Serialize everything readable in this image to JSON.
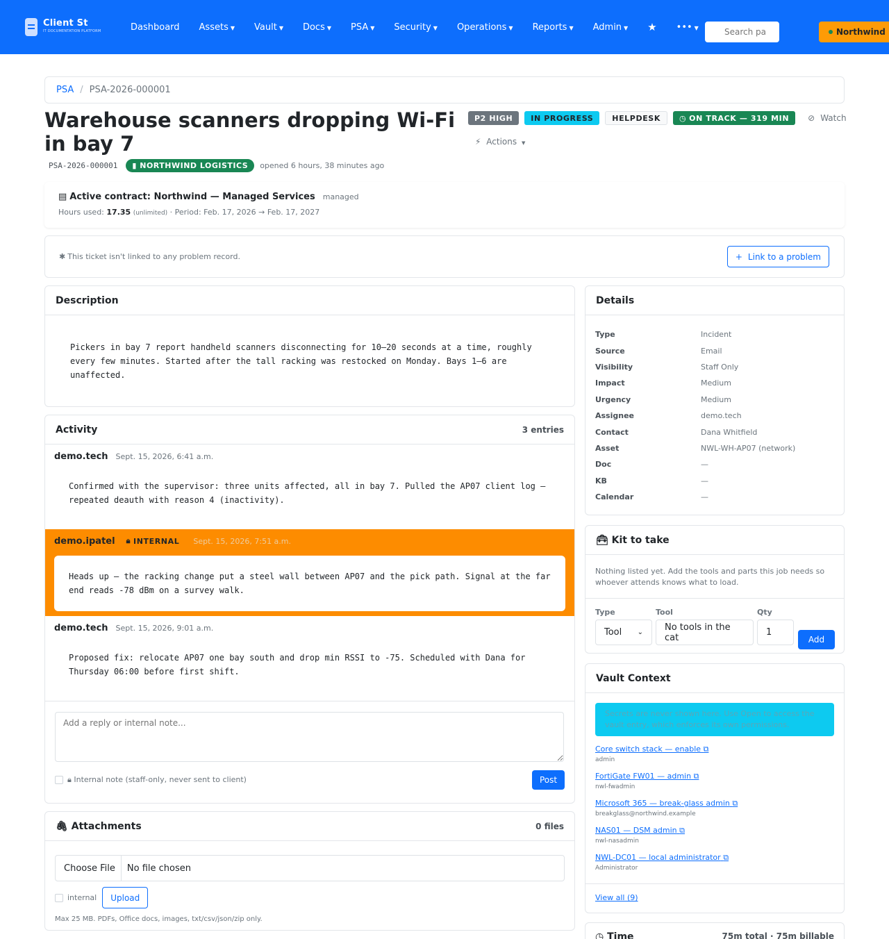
{
  "nav": {
    "brand_name": "Client St",
    "brand_sub": "IT DOCUMENTATION PLATFORM",
    "items": [
      "Dashboard",
      "Assets",
      "Vault",
      "Docs",
      "PSA",
      "Security",
      "Operations",
      "Reports",
      "Admin"
    ],
    "search_placeholder": "Search pa",
    "tenant": "Northwind L"
  },
  "breadcrumb": {
    "root": "PSA",
    "sep": "/",
    "current": "PSA-2026-000001"
  },
  "ticket": {
    "title": "Warehouse scanners dropping Wi-Fi in bay 7",
    "id": "PSA-2026-000001",
    "client": "NORTHWIND LOGISTICS",
    "opened": "opened 6 hours, 38 minutes ago",
    "priority": "P2 HIGH",
    "status": "IN PROGRESS",
    "queue": "HELPDESK",
    "sla": "ON TRACK — 319 MIN",
    "watch": "Watch",
    "actions": "Actions"
  },
  "contract": {
    "title": "Active contract: Northwind — Managed Services",
    "tag": "managed",
    "hours_label": "Hours used:",
    "hours": "17.35",
    "unlimited": "(unlimited)",
    "period": "· Period: Feb. 17, 2026 → Feb. 17, 2027"
  },
  "problem": {
    "text": "This ticket isn't linked to any problem record.",
    "button": "Link to a problem"
  },
  "description": {
    "title": "Description",
    "text": "Pickers in bay 7 report handheld scanners disconnecting for 10–20 seconds at a time, roughly every few minutes. Started after the tall racking was restocked on Monday. Bays 1–6 are unaffected."
  },
  "activity": {
    "title": "Activity",
    "count": "3 entries",
    "entries": [
      {
        "author": "demo.tech",
        "time": "Sept. 15, 2026, 6:41 a.m.",
        "body": "Confirmed with the supervisor: three units affected, all in bay 7. Pulled the AP07 client log — repeated deauth with reason 4 (inactivity)."
      },
      {
        "author": "demo.ipatel",
        "tag": "INTERNAL",
        "time": "Sept. 15, 2026, 7:51 a.m.",
        "body": "Heads up — the racking change put a steel wall between AP07 and the pick path. Signal at the far end reads -78 dBm on a survey walk."
      },
      {
        "author": "demo.tech",
        "time": "Sept. 15, 2026, 9:01 a.m.",
        "body": "Proposed fix: relocate AP07 one bay south and drop min RSSI to -75. Scheduled with Dana for Thursday 06:00 before first shift."
      }
    ],
    "reply_placeholder": "Add a reply or internal note...",
    "internal_label": "Internal note (staff-only, never sent to client)",
    "post": "Post"
  },
  "attachments": {
    "title": "Attachments",
    "count": "0 files",
    "choose": "Choose File",
    "no_file": "No file chosen",
    "internal": "internal",
    "upload": "Upload",
    "note": "Max 25 MB. PDFs, Office docs, images, txt/csv/json/zip only."
  },
  "details": {
    "title": "Details",
    "rows": [
      {
        "label": "Type",
        "value": "Incident"
      },
      {
        "label": "Source",
        "value": "Email"
      },
      {
        "label": "Visibility",
        "value": "Staff Only"
      },
      {
        "label": "Impact",
        "value": "Medium"
      },
      {
        "label": "Urgency",
        "value": "Medium"
      },
      {
        "label": "Assignee",
        "value": "demo.tech"
      },
      {
        "label": "Contact",
        "value": "Dana Whitfield"
      },
      {
        "label": "Asset",
        "value": "NWL-WH-AP07 (network)"
      },
      {
        "label": "Doc",
        "value": "—"
      },
      {
        "label": "KB",
        "value": "—"
      },
      {
        "label": "Calendar",
        "value": "—"
      }
    ]
  },
  "kit": {
    "title": "Kit to take",
    "text": "Nothing listed yet. Add the tools and parts this job needs so whoever attends knows what to load.",
    "type_label": "Type",
    "tool_label": "Tool",
    "qty_label": "Qty",
    "type_value": "Tool",
    "tool_value": "No tools in the cat",
    "qty_value": "1",
    "add": "Add"
  },
  "vault": {
    "title": "Vault Context",
    "alert": "Secrets are never shown here. Use Open to access the vault entry, which enforces its own permissions.",
    "items": [
      {
        "name": "Core switch stack — enable",
        "user": "admin"
      },
      {
        "name": "FortiGate FW01 — admin",
        "user": "nwl-fwadmin"
      },
      {
        "name": "Microsoft 365 — break-glass admin",
        "user": "breakglass@northwind.example"
      },
      {
        "name": "NAS01 — DSM admin",
        "user": "nwl-nasadmin"
      },
      {
        "name": "NWL-DC01 — local administrator",
        "user": "Administrator"
      }
    ],
    "view_all": "View all (9)"
  },
  "time": {
    "title": "Time",
    "summary": "75m total · 75m billable"
  },
  "colors": {
    "primary": "#0d6efd",
    "success": "#198754",
    "warning": "#fd9b06",
    "info": "#0dcaf0",
    "internal": "#fd8c00"
  }
}
